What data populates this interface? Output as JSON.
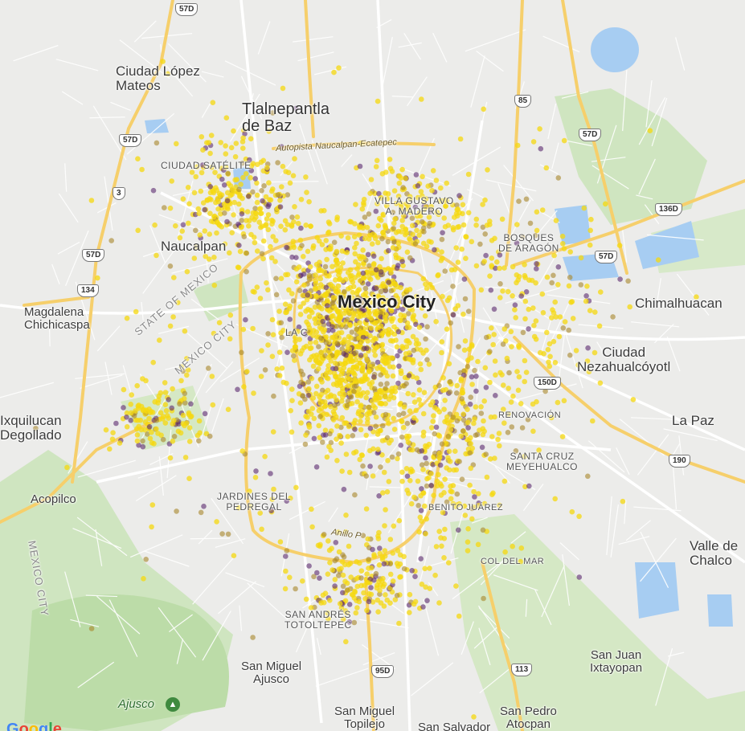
{
  "map": {
    "labels": {
      "ciudad_lopez_mateos": "Ciudad López\nMateos",
      "tlalnepantla": "Tlalnepantla\nde Baz",
      "ciudad_satelite": "CIUDAD SATÉLITE",
      "naucalpan": "Naucalpan",
      "magdalena": "Magdalena\nChichicaspa",
      "state_of_mexico": "STATE OF MEXICO",
      "mexico_city_diag": "MEXICO CITY",
      "mexico_city_vertical": "MEXICO CITY",
      "mexico_city": "Mexico City",
      "villa_gustavo": "VILLA GUSTAVO\nA. MADERO",
      "bosques_aragon": "BOSQUES\nDE ARAGÓN",
      "chimalhuacan": "Chimalhuacan",
      "nezahualcoyotl": "Ciudad\nNezahualcóyotl",
      "la_paz": "La Paz",
      "renovacion": "RENOVACIÓN",
      "santa_cruz": "SANTA CRUZ\nMEYEHUALCO",
      "benito_juarez": "BENITO JUÁREZ",
      "col_del_mar": "COL DEL MAR",
      "valle_chalco": "Valle de\nChalco",
      "ixquilucan": "Ixquilucan\nDegollado",
      "acopilco": "Acopilco",
      "jardines": "JARDINES DEL\nPEDREGAL",
      "san_andres": "SAN ANDRÉS\nTOTOLTEPEC",
      "san_miguel_ajusco": "San Miguel\nAjusco",
      "ajusco": "Ajusco",
      "san_juan": "San Juan\nIxtayopan",
      "san_miguel_topilejo": "San Miguel\nTopilejo",
      "san_salvador": "San Salvador",
      "san_pedro": "San Pedro\nAtocpan",
      "la_co": "LA C",
      "autopista": "Autopista Naucalpan-Ecatepec",
      "anillo": "Anillo P"
    },
    "shields": [
      "57D",
      "57D",
      "57D",
      "57D",
      "85",
      "57D",
      "3",
      "134",
      "136D",
      "150D",
      "190",
      "95D",
      "113",
      "57D"
    ],
    "google_logo": [
      "G",
      "o",
      "o",
      "g",
      "l",
      "e"
    ],
    "colors": {
      "land": "#ececea",
      "water": "#a7cdf2",
      "park": "#cfe5c0",
      "highway": "#f6cf6b",
      "arterial": "#ffffff",
      "dot_yellow": "#f5d80f",
      "dot_purple": "#5b2a6e",
      "dot_olive": "#a8872a"
    }
  }
}
